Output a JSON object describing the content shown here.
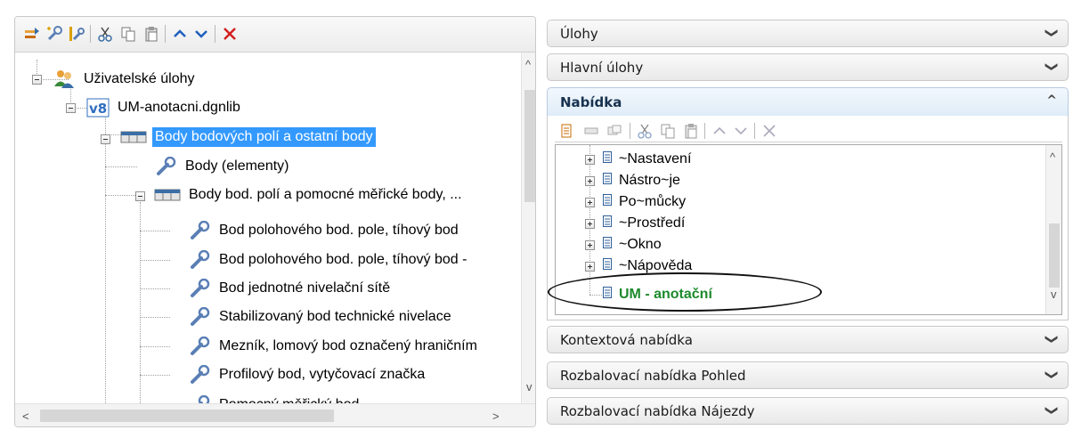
{
  "left_panel": {
    "toolbar": {
      "buttons": [
        {
          "name": "new-task-icon",
          "color": "#c96a00"
        },
        {
          "name": "new-tool-icon",
          "color": "#5a7fb5"
        },
        {
          "name": "new-tool-alt-icon",
          "color": "#5a7fb5"
        },
        {
          "name": "cut-icon",
          "color": "#3a6ea5"
        },
        {
          "name": "copy-icon",
          "color": "#777777"
        },
        {
          "name": "paste-icon",
          "color": "#777777"
        },
        {
          "name": "move-up-icon",
          "color": "#1f5fbf"
        },
        {
          "name": "move-down-icon",
          "color": "#1f5fbf"
        },
        {
          "name": "delete-icon",
          "color": "#d41f1f"
        }
      ]
    },
    "tree": [
      {
        "label": "Uživatelské úlohy",
        "icon": "users-icon"
      },
      {
        "label": "UM-anotacni.dgnlib",
        "icon": "v8-icon"
      },
      {
        "label": "Body bodových polí a ostatní body",
        "icon": "toolbox-icon",
        "selected": true
      },
      {
        "label": "Body (elementy)",
        "icon": "wrench-icon"
      },
      {
        "label": "Body bod. polí a pomocné měřické body, ...",
        "icon": "toolbox-icon"
      },
      {
        "label": "Bod polohového bod. pole, tíhový bod",
        "icon": "wrench-icon"
      },
      {
        "label": "Bod polohového bod. pole, tíhový bod -",
        "icon": "wrench-icon"
      },
      {
        "label": "Bod jednotné nivelační sítě",
        "icon": "wrench-icon"
      },
      {
        "label": "Stabilizovaný bod technické nivelace",
        "icon": "wrench-icon"
      },
      {
        "label": "Mezník, lomový bod označený hraničním",
        "icon": "wrench-icon"
      },
      {
        "label": "Profilový bod, vytyčovací značka",
        "icon": "wrench-icon"
      },
      {
        "label": "Pomocný měřický bod",
        "icon": "wrench-icon"
      }
    ],
    "scroll": {
      "up": "^",
      "down": "v",
      "left": "<",
      "right": ">"
    }
  },
  "right_panel": {
    "sections_top": [
      {
        "label": "Úlohy",
        "chevron": "❯"
      },
      {
        "label": "Hlavní úlohy",
        "chevron": "❯"
      }
    ],
    "active_section": {
      "label": "Nabídka",
      "chevron": "^"
    },
    "toolbar_icons": [
      "new-menu-icon",
      "edit-icon",
      "copy-item-icon",
      "cut-icon",
      "copy-icon",
      "paste-icon",
      "move-up-icon",
      "move-down-icon",
      "delete-icon"
    ],
    "menu_items": [
      {
        "label": "~Nastavení",
        "expandable": true
      },
      {
        "label": "Nástro~je",
        "expandable": true
      },
      {
        "label": "Po~můcky",
        "expandable": true
      },
      {
        "label": "~Prostředí",
        "expandable": true
      },
      {
        "label": "~Okno",
        "expandable": true
      },
      {
        "label": "~Nápověda",
        "expandable": true
      },
      {
        "label": "UM - anotační",
        "expandable": false,
        "highlighted": true
      }
    ],
    "sections_bottom": [
      {
        "label": "Kontextová nabídka",
        "chevron": "❯"
      },
      {
        "label": "Rozbalovací nabídka Pohled",
        "chevron": "❯"
      },
      {
        "label": "Rozbalovací nabídka Nájezdy",
        "chevron": "❯"
      }
    ],
    "colors": {
      "highlight_text": "#1d8a2c",
      "selection": "#3399ff"
    }
  }
}
